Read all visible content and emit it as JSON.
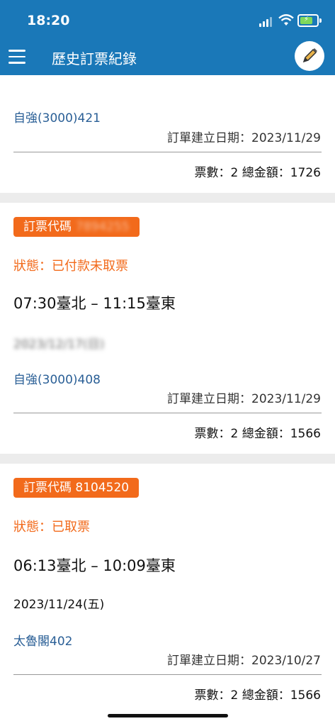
{
  "status_bar": {
    "time": "18:20"
  },
  "app_bar": {
    "title": "歷史訂票紀錄"
  },
  "orders": [
    {
      "train": "自強(3000)421",
      "created": "訂單建立日期：2023/11/29",
      "total": "票數：2 總金額：1726"
    },
    {
      "badge_label": "訂票代碼",
      "code_blurred": "7894255",
      "status": "狀態：已付款未取票",
      "route": "07:30臺北 – 11:15臺東",
      "date_blurred": "2023/12/17(日)",
      "train": "自強(3000)408",
      "created": "訂單建立日期：2023/11/29",
      "total": "票數：2 總金額：1566"
    },
    {
      "badge_label": "訂票代碼 8104520",
      "status": "狀態：已取票",
      "route": "06:13臺北 – 10:09臺東",
      "date": "2023/11/24(五)",
      "train": "太魯閣402",
      "created": "訂單建立日期：2023/10/27",
      "total": "票數：2 總金額：1566"
    }
  ],
  "colors": {
    "primary": "#1a78b8",
    "accent": "#f26a1b",
    "train_link": "#2a5f96"
  }
}
